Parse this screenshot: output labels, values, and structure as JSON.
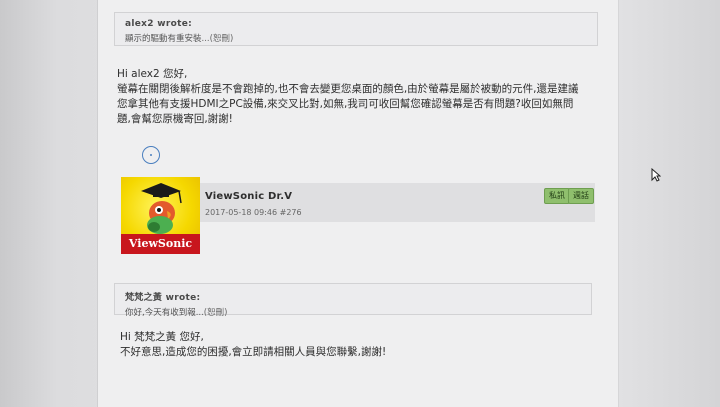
{
  "quote1": {
    "author": "alex2 wrote:",
    "text": "顯示的驅動有重安裝",
    "more": "...(恕刪)"
  },
  "reply1": {
    "greeting": "Hi alex2 您好,",
    "lines": [
      "螢幕在關閉後解析度是不會跑掉的,也不會去變更您桌面的顏色,由於螢幕是屬於被動的元件,還是建議",
      "您拿其他有支援HDMI之PC設備,來交叉比對,如無,我司可收回幫您確認螢幕是否有問題?收回如無問",
      "題,會幫您原機寄回,謝謝!"
    ]
  },
  "post": {
    "author": "ViewSonic Dr.V",
    "meta": "2017-05-18 09:46  #276",
    "avatar_brand": "ViewSonic",
    "actions": [
      "私訊",
      "週話"
    ]
  },
  "quote2": {
    "author": "梵梵之黃 wrote:",
    "text": "你好,今天有收到報",
    "more": "...(恕刪)"
  },
  "reply2": {
    "greeting": "Hi 梵梵之黃 您好,",
    "lines": [
      "不好意思,造成您的困擾,會立即請相關人員與您聯繫,謝謝!"
    ]
  },
  "colors": {
    "brand_red": "#c8161d",
    "avatar_yellow": "#f5d800",
    "button_green": "#8fbf6d"
  }
}
